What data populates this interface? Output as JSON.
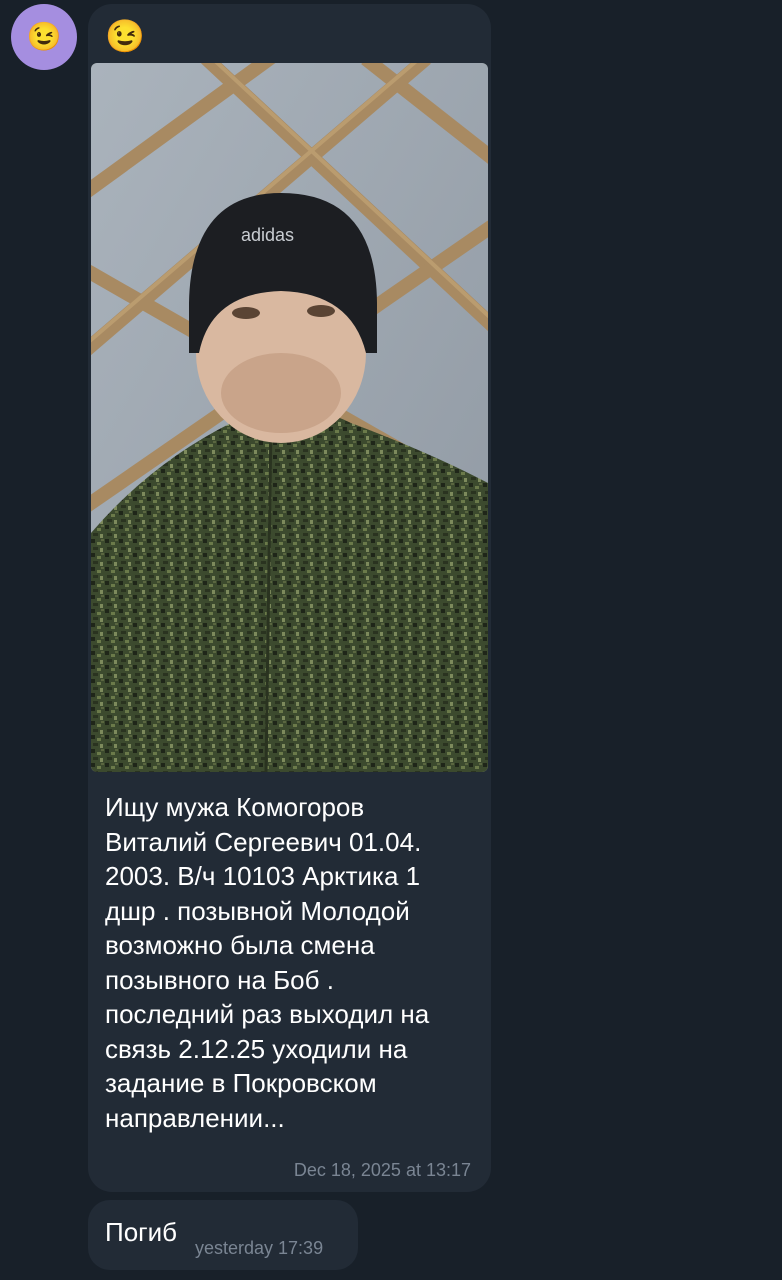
{
  "sender": {
    "avatar_emoji": "😉",
    "avatar_color": "#a58ee0"
  },
  "messages": [
    {
      "emoji": "😉",
      "photo": {
        "icon": "photo-soldier-selfie",
        "hat_text": "adidas",
        "colors": {
          "ceiling": "#9aa3ad",
          "beams": "#a88a62",
          "camo_base": "#3c4a2e",
          "hat": "#1c1e22"
        }
      },
      "text": "Ищу мужа Комогоров\nВиталий Сергеевич 01.04.\n2003. В/ч 10103 Арктика 1\nдшр . позывной Молодой\nвозможно была смена\nпозывного на Боб .\nпоследний раз выходил на\nсвязь 2.12.25 уходили на\nзадание в Покровском\nнаправлении...",
      "timestamp": "Dec 18, 2025 at 13:17"
    },
    {
      "text": "Погиб",
      "timestamp": "yesterday 17:39"
    }
  ],
  "colors": {
    "background": "#182029",
    "bubble": "#222b36",
    "timestamp": "#7a8593"
  }
}
